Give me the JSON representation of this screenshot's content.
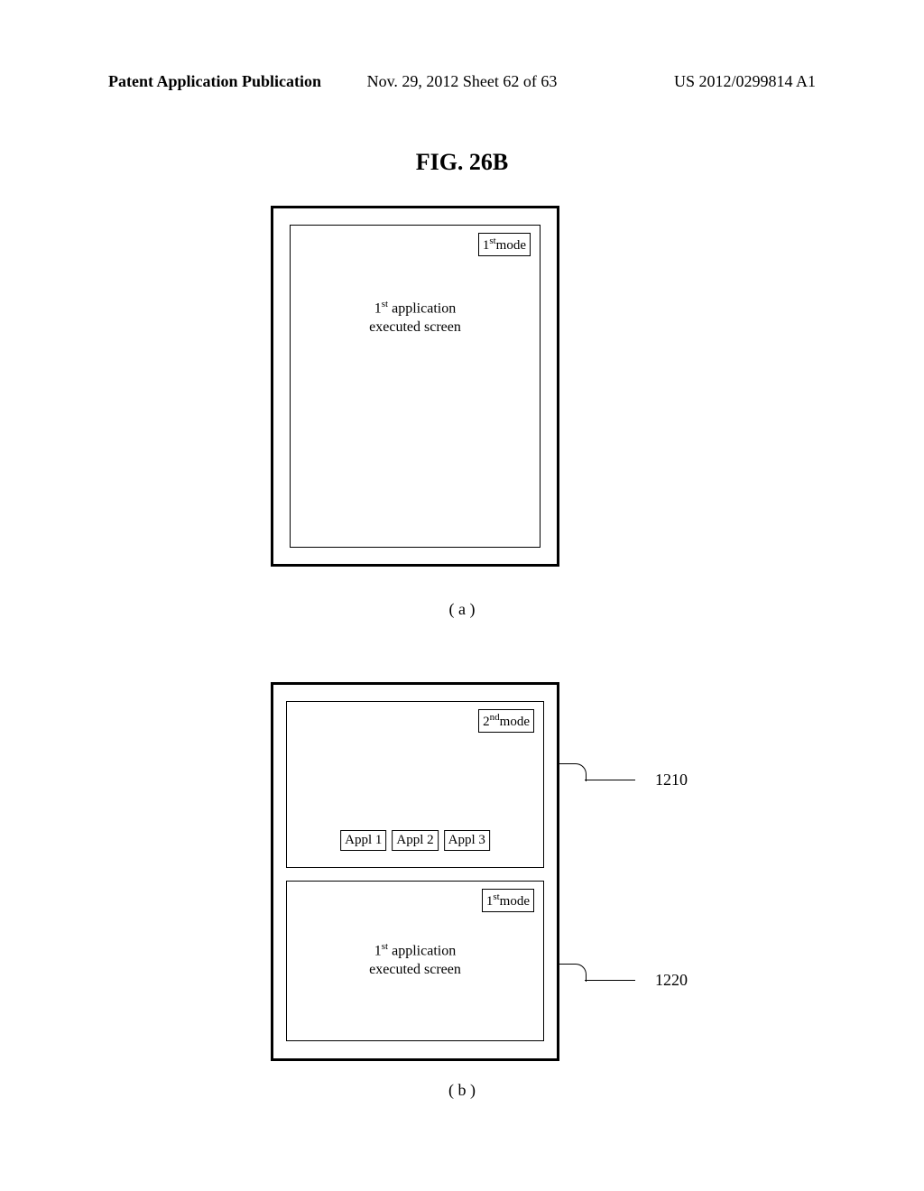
{
  "header": {
    "left": "Patent Application Publication",
    "center": "Nov. 29, 2012  Sheet 62 of 63",
    "right": "US 2012/0299814 A1"
  },
  "figure_title": "FIG. 26B",
  "device_a": {
    "mode_prefix": "1",
    "mode_suffix": "st",
    "mode_word": "mode",
    "app_line1_prefix": "1",
    "app_line1_suffix": "st",
    "app_line1_rest": " application",
    "app_line2": "executed screen"
  },
  "subfig_a": "( a )",
  "device_b": {
    "top_mode_prefix": "2",
    "top_mode_suffix": "nd",
    "top_mode_word": "mode",
    "buttons": [
      "Appl 1",
      "Appl 2",
      "Appl 3"
    ],
    "bottom_mode_prefix": "1",
    "bottom_mode_suffix": "st",
    "bottom_mode_word": "mode",
    "app_line1_prefix": "1",
    "app_line1_suffix": "st",
    "app_line1_rest": " application",
    "app_line2": "executed screen"
  },
  "leaders": {
    "ref1": "1210",
    "ref2": "1220"
  },
  "subfig_b": "( b )"
}
